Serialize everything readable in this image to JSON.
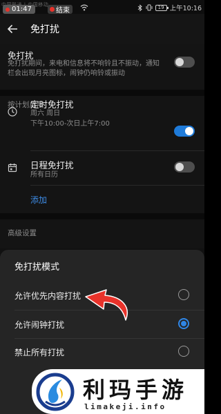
{
  "status_bar": {
    "carrier_text": "中国联通 | 中国移动",
    "call_time": "01:47",
    "end_call_label": "结束",
    "battery_level": "19",
    "clock": "上午10:16"
  },
  "app_bar": {
    "title": "免打扰"
  },
  "dnd_row": {
    "title": "免打扰",
    "description": "免打扰期间，来电和信息将不响铃且不振动，通知栏会出现月亮图标，闹钟仍响铃或振动",
    "enabled": false
  },
  "schedule_section": {
    "label": "按计划启用",
    "timed": {
      "title": "定时免打扰",
      "days": "周六 周日",
      "time_range": "下午10:00-次日上午7:00",
      "enabled": true,
      "icon": "clock-icon"
    },
    "calendar": {
      "title": "日程免打扰",
      "subtitle": "所有日历",
      "enabled": false,
      "icon": "calendar-icon"
    },
    "add_label": "添加"
  },
  "advanced_section": {
    "label": "高级设置"
  },
  "mode_sheet": {
    "title": "免打扰模式",
    "options": [
      {
        "label": "允许优先内容打扰",
        "selected": false
      },
      {
        "label": "允许闹钟打扰",
        "selected": true
      },
      {
        "label": "禁止所有打扰",
        "selected": false
      }
    ]
  },
  "watermark": {
    "name": "利玛手游",
    "url": "limakeji.info"
  },
  "colors": {
    "accent": "#2f86e6",
    "annotation_arrow": "#e8322a"
  }
}
